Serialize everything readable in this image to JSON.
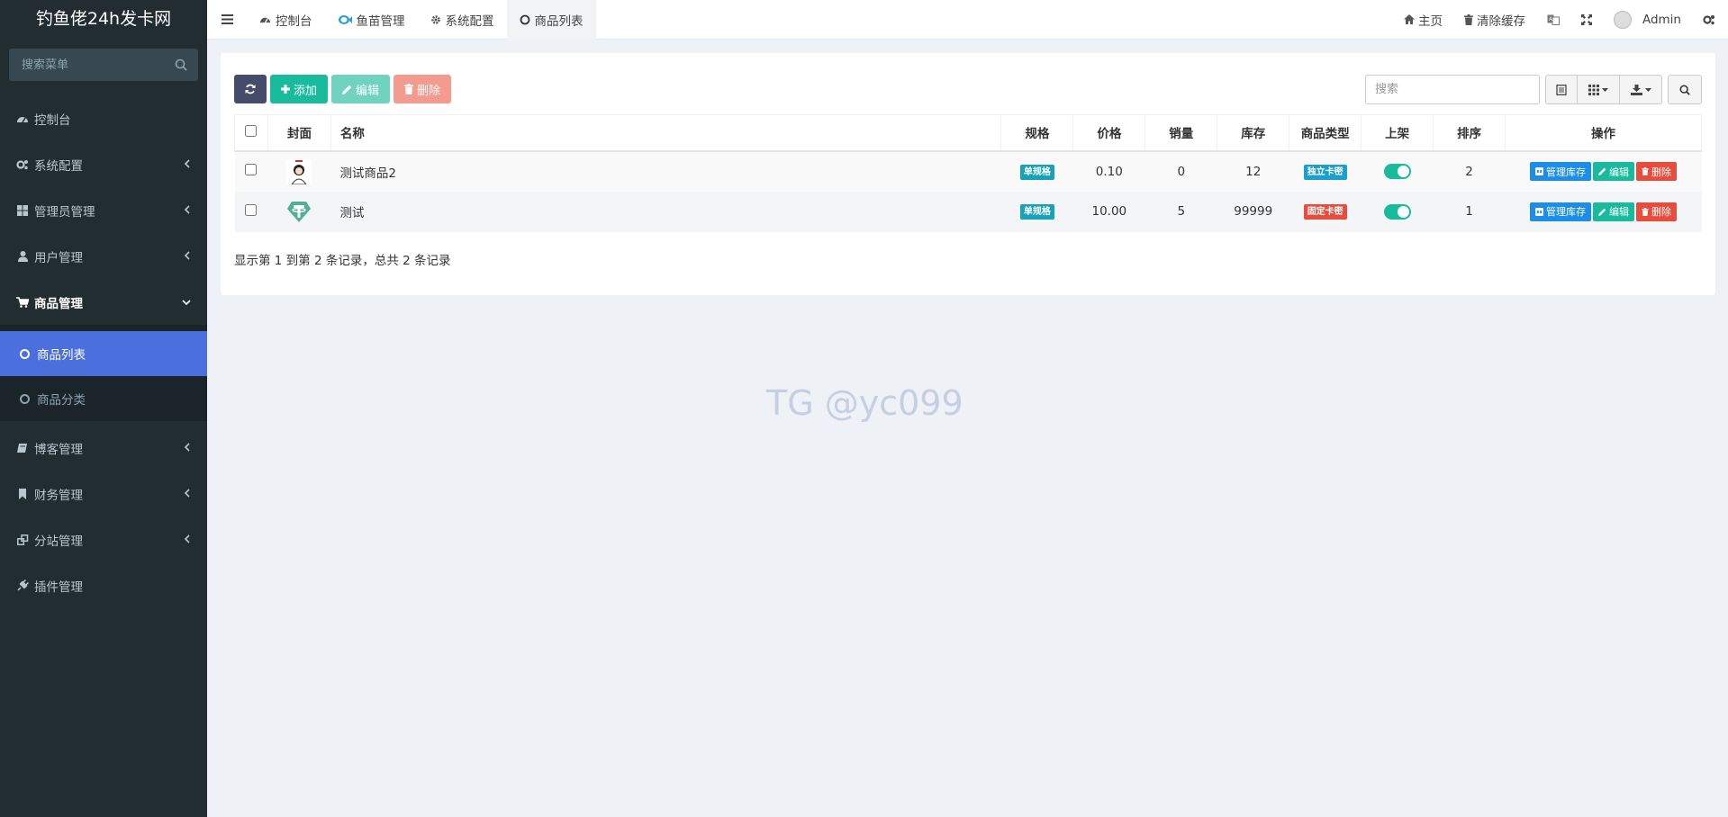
{
  "brand": "钓鱼佬24h发卡网",
  "sidebar": {
    "search_placeholder": "搜索菜单",
    "items": [
      {
        "label": "控制台"
      },
      {
        "label": "系统配置"
      },
      {
        "label": "管理员管理"
      },
      {
        "label": "用户管理"
      },
      {
        "label": "商品管理"
      }
    ],
    "sub_items": [
      {
        "label": "商品列表"
      },
      {
        "label": "商品分类"
      }
    ],
    "items_after": [
      {
        "label": "博客管理"
      },
      {
        "label": "财务管理"
      },
      {
        "label": "分站管理"
      },
      {
        "label": "插件管理"
      }
    ]
  },
  "header": {
    "tabs": [
      {
        "label": "控制台"
      },
      {
        "label": "鱼苗管理"
      },
      {
        "label": "系统配置"
      },
      {
        "label": "商品列表"
      }
    ],
    "right": {
      "home": "主页",
      "clear_cache": "清除缓存",
      "user": "Admin"
    }
  },
  "toolbar": {
    "add": "添加",
    "edit": "编辑",
    "delete": "删除",
    "search_placeholder": "搜索"
  },
  "table": {
    "headers": [
      "封面",
      "名称",
      "规格",
      "价格",
      "销量",
      "库存",
      "商品类型",
      "上架",
      "排序",
      "操作"
    ],
    "rows": [
      {
        "name": "测试商品2",
        "spec": "单规格",
        "price": "0.10",
        "sales": "0",
        "stock": "12",
        "type": "独立卡密",
        "on_shelf": true,
        "sort": "2"
      },
      {
        "name": "测试",
        "spec": "单规格",
        "price": "10.00",
        "sales": "5",
        "stock": "99999",
        "type": "固定卡密",
        "on_shelf": true,
        "sort": "1"
      }
    ],
    "actions": {
      "manage": "管理库存",
      "edit": "编辑",
      "delete": "删除"
    }
  },
  "summary": "显示第 1 到第 2 条记录，总共 2 条记录",
  "watermark": "TG @yc099",
  "colors": {
    "sidebar": "#222d32",
    "active": "#4b6fdd",
    "green": "#18bc9c",
    "blue": "#1d8ee8",
    "red": "#e74c3c"
  }
}
